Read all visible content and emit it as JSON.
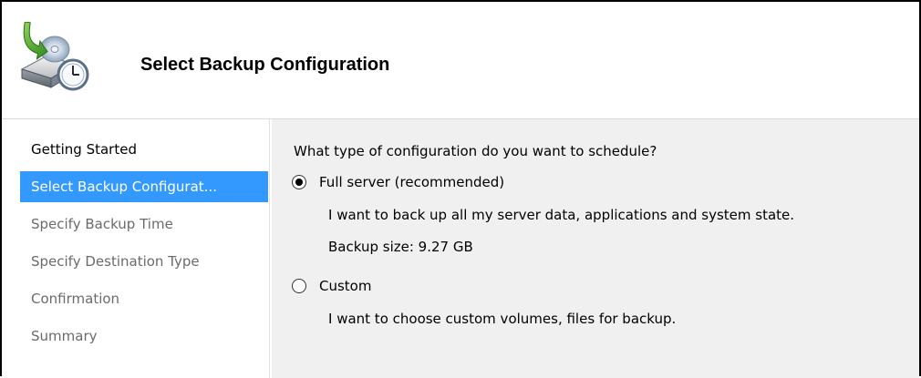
{
  "header": {
    "title": "Select Backup Configuration",
    "icon": "backup-drive-clock-icon"
  },
  "sidebar": {
    "items": [
      {
        "label": "Getting Started",
        "state": "visited"
      },
      {
        "label": "Select Backup Configurat...",
        "state": "selected"
      },
      {
        "label": "Specify Backup Time",
        "state": "pending"
      },
      {
        "label": "Specify Destination Type",
        "state": "pending"
      },
      {
        "label": "Confirmation",
        "state": "pending"
      },
      {
        "label": "Summary",
        "state": "pending"
      }
    ]
  },
  "main": {
    "question": "What type of configuration do you want to schedule?",
    "options": [
      {
        "label": "Full server (recommended)",
        "checked": true,
        "description": "I want to back up all my server data, applications and system state.",
        "size": "Backup size: 9.27 GB"
      },
      {
        "label": "Custom",
        "checked": false,
        "description": "I want to choose custom volumes, files for backup."
      }
    ]
  },
  "colors": {
    "selection": "#3399ff",
    "content_bg": "#f0f0f0",
    "inactive_text": "#6b6b6b"
  }
}
